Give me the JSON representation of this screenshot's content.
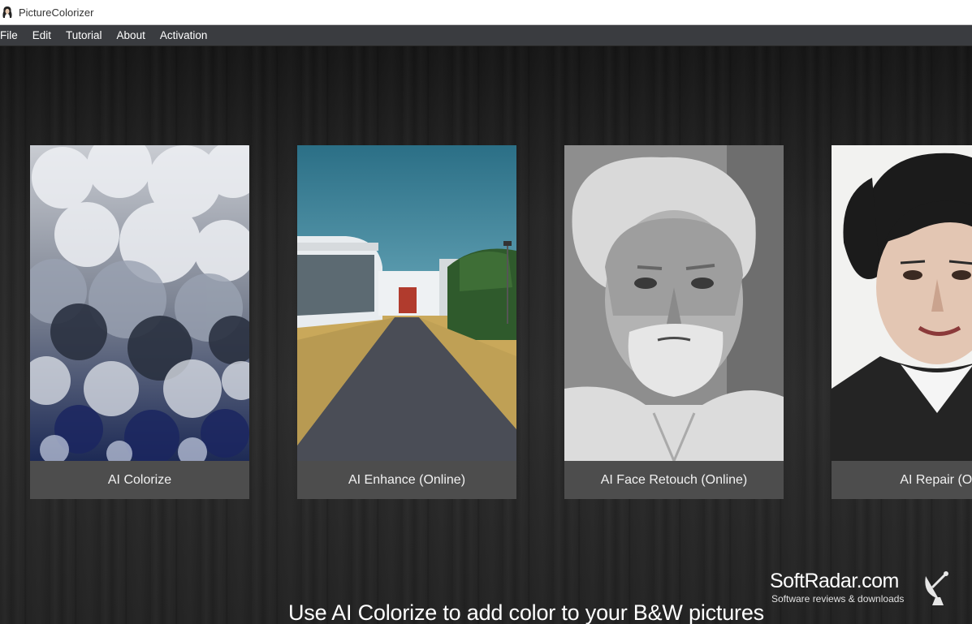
{
  "window": {
    "title": "PictureColorizer",
    "app_icon": "portrait-icon"
  },
  "menu": [
    "File",
    "Edit",
    "Tutorial",
    "About",
    "Activation"
  ],
  "cards": [
    {
      "label": "AI Colorize",
      "image": "clouds"
    },
    {
      "label": "AI Enhance (Online)",
      "image": "building-road"
    },
    {
      "label": "AI Face Retouch (Online)",
      "image": "old-man-portrait"
    },
    {
      "label": "AI Repair (Onl",
      "image": "woman-portrait"
    }
  ],
  "caption": "Use AI Colorize to add color to your B&W pictures",
  "watermark": {
    "title": "SoftRadar.com",
    "subtitle": "Software reviews & downloads",
    "icon": "satellite-dish-icon"
  },
  "colors": {
    "menubar": "#3a3c40",
    "card_label_bg": "#4d4d4d",
    "background": "#262626"
  }
}
